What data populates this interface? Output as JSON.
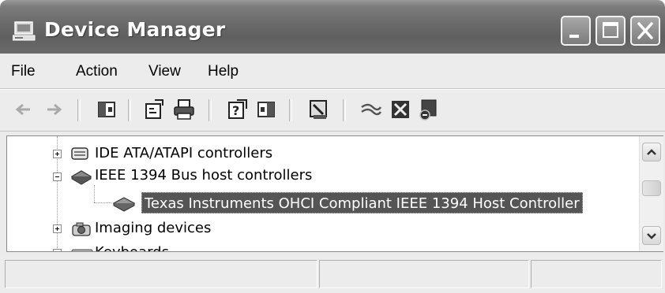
{
  "window": {
    "title": "Device Manager",
    "icon": "computer-icon",
    "controls": [
      "minimize-icon",
      "maximize-icon",
      "close-icon"
    ]
  },
  "menu": {
    "items": [
      {
        "label": "File"
      },
      {
        "label": "Action"
      },
      {
        "label": "View"
      },
      {
        "label": "Help"
      }
    ]
  },
  "toolbar": {
    "buttons": [
      "back-icon",
      "forward-icon",
      "show-hide-console-tree-icon",
      "properties-icon",
      "print-icon",
      "help-icon",
      "show-hide-action-pane-icon",
      "scan-hardware-icon",
      "update-driver-icon",
      "uninstall-icon",
      "disable-icon"
    ]
  },
  "tree": {
    "items": [
      {
        "label": "IDE ATA/ATAPI controllers",
        "expanded": false,
        "icon": "ide-controller-icon"
      },
      {
        "label": "IEEE 1394 Bus host controllers",
        "expanded": true,
        "icon": "ieee1394-controller-icon"
      },
      {
        "label": "Texas Instruments OHCI Compliant IEEE 1394 Host Controller",
        "selected": true,
        "icon": "ieee1394-device-icon"
      },
      {
        "label": "Imaging devices",
        "expanded": false,
        "icon": "imaging-device-icon"
      },
      {
        "label": "Keyboards",
        "expanded": false,
        "icon": "keyboard-icon",
        "clipped": true
      }
    ]
  },
  "statusbar": {
    "panes": [
      "",
      "",
      ""
    ]
  },
  "colors": {
    "titlebar": "#6a6a6a",
    "selection": "#555555",
    "chrome": "#ececec"
  }
}
